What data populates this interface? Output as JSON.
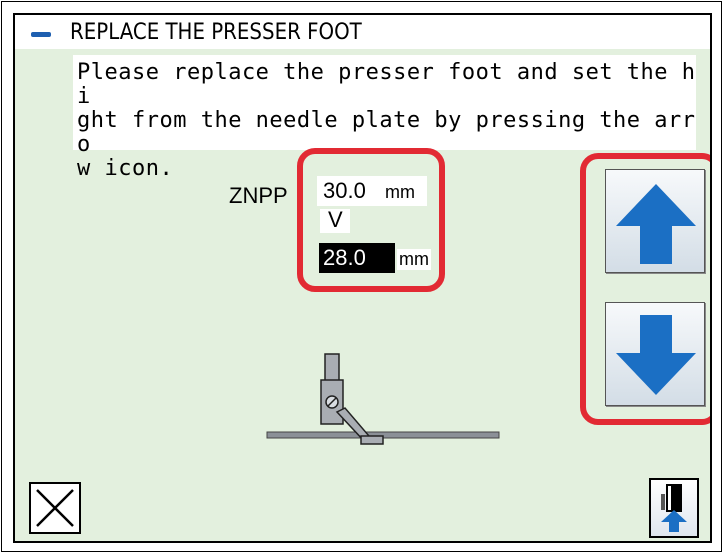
{
  "title": {
    "text": "REPLACE THE PRESSER FOOT",
    "dash_color": "#1e5fb0"
  },
  "message": {
    "text": "Please replace the presser foot and set the hi\nght from the needle plate by pressing the arro\nw icon."
  },
  "height_setting": {
    "label": "ZNPP",
    "current_value": "30.0",
    "current_unit": "mm",
    "direction_label": "V",
    "target_value": "28.0",
    "target_unit": "mm"
  },
  "controls": {
    "up_arrow_icon": "arrow-up-icon",
    "down_arrow_icon": "arrow-down-icon",
    "close_icon": "close-x-icon",
    "presser_foot_lift_icon": "presser-foot-lift-icon"
  },
  "colors": {
    "highlight": "#e22a33",
    "panel_background": "#e3f0de",
    "arrow_blue": "#1b6fc4"
  }
}
